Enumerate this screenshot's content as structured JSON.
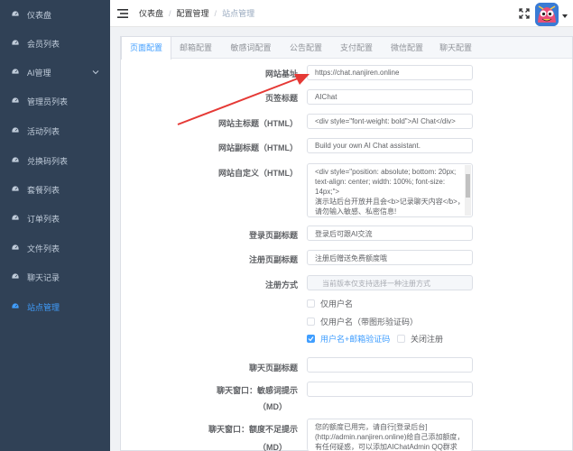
{
  "sidebar": {
    "items": [
      {
        "label": "仪表盘",
        "icon": "dashboard-icon"
      },
      {
        "label": "会员列表",
        "icon": "dashboard-icon"
      },
      {
        "label": "AI管理",
        "icon": "dashboard-icon"
      },
      {
        "label": "管理员列表",
        "icon": "dashboard-icon"
      },
      {
        "label": "活动列表",
        "icon": "dashboard-icon"
      },
      {
        "label": "兑换码列表",
        "icon": "dashboard-icon"
      },
      {
        "label": "套餐列表",
        "icon": "dashboard-icon"
      },
      {
        "label": "订单列表",
        "icon": "dashboard-icon"
      },
      {
        "label": "文件列表",
        "icon": "dashboard-icon"
      },
      {
        "label": "聊天记录",
        "icon": "dashboard-icon"
      },
      {
        "label": "站点管理",
        "icon": "dashboard-icon"
      }
    ],
    "active_index": 10
  },
  "breadcrumb": [
    "仪表盘",
    "配置管理",
    "站点管理"
  ],
  "tabs": [
    "页面配置",
    "邮箱配置",
    "敏感词配置",
    "公告配置",
    "支付配置",
    "微信配置",
    "聊天配置"
  ],
  "active_tab": 0,
  "form": {
    "site_url": {
      "label": "网站基址",
      "value": "https://chat.nanjiren.online"
    },
    "page_title": {
      "label": "页签标题",
      "value": "AIChat"
    },
    "main_title": {
      "label": "网站主标题（HTML）",
      "value": "<div style=\"font-weight: bold\">AI Chat</div>"
    },
    "sub_title": {
      "label": "网站副标题（HTML）",
      "value": "Build your own AI Chat assistant."
    },
    "custom": {
      "label": "网站自定义（HTML）",
      "lines": [
        "<div style=\"position: absolute; bottom: 20px;",
        "text-align: center; width: 100%; font-size:",
        "14px;\">",
        "演示站后台开放并且会<b>记录聊天内容</b>，",
        "请勿输入敏感、私密信息!"
      ]
    },
    "login_subtitle": {
      "label": "登录页副标题",
      "value": "登录后可跟AI交流"
    },
    "register_subtitle": {
      "label": "注册页副标题",
      "value": "注册后赠送免费额度哦"
    },
    "register_mode": {
      "label": "注册方式",
      "placeholder": "当前版本仅支持选择一种注册方式",
      "options": [
        {
          "label": "仅用户名",
          "checked": false
        },
        {
          "label": "仅用户名（带图形验证码）",
          "checked": false
        },
        {
          "label": "用户名+邮箱验证码",
          "checked": true
        },
        {
          "label": "关闭注册",
          "checked": false
        }
      ]
    },
    "chat_subtitle": {
      "label": "聊天页副标题",
      "value": ""
    },
    "sensitive_tip": {
      "label_line1": "聊天窗口：敏感词提示",
      "label_line2": "（MD）",
      "value": ""
    },
    "quota_tip": {
      "label_line1": "聊天窗口：额度不足提示",
      "label_line2": "（MD）",
      "lines": [
        "您的额度已用完，请自行[登录后台]",
        "(http://admin.nanjiren.online)给自己添加额度，",
        "有任何疑惑，可以添加AIChatAdmin QQ群求助。"
      ]
    }
  },
  "colors": {
    "sidebar_bg": "#304156",
    "accent": "#409eff",
    "arrow": "#e53935"
  }
}
